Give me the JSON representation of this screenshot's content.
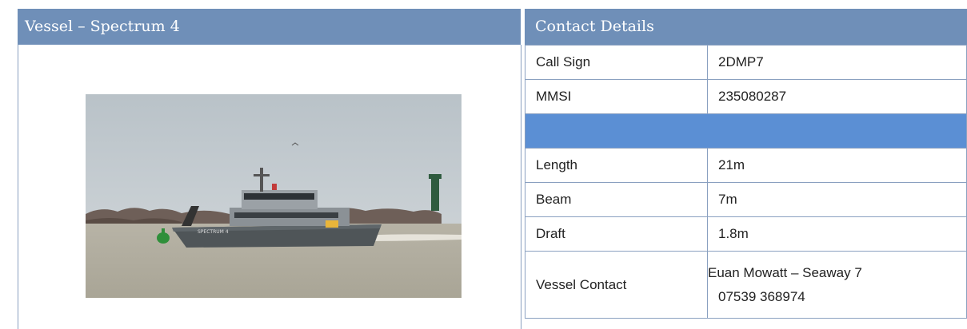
{
  "vessel_panel": {
    "title": "Vessel – Spectrum 4",
    "photo_hull_text": "SPECTRUM 4"
  },
  "contact_panel": {
    "title": "Contact Details",
    "rows_top": [
      {
        "label": "Call Sign",
        "value": "2DMP7"
      },
      {
        "label": "MMSI",
        "value": "235080287"
      }
    ],
    "rows_bottom": [
      {
        "label": "Length",
        "value": "21m"
      },
      {
        "label": "Beam",
        "value": "7m"
      },
      {
        "label": "Draft",
        "value": "1.8m"
      }
    ],
    "vessel_contact": {
      "label": "Vessel Contact",
      "name": "Euan Mowatt – Seaway 7",
      "phone": "07539 368974"
    }
  },
  "colors": {
    "header_bg": "#6f8fb8",
    "separator_bg": "#5b8fd4",
    "border": "#8aa0c0"
  }
}
